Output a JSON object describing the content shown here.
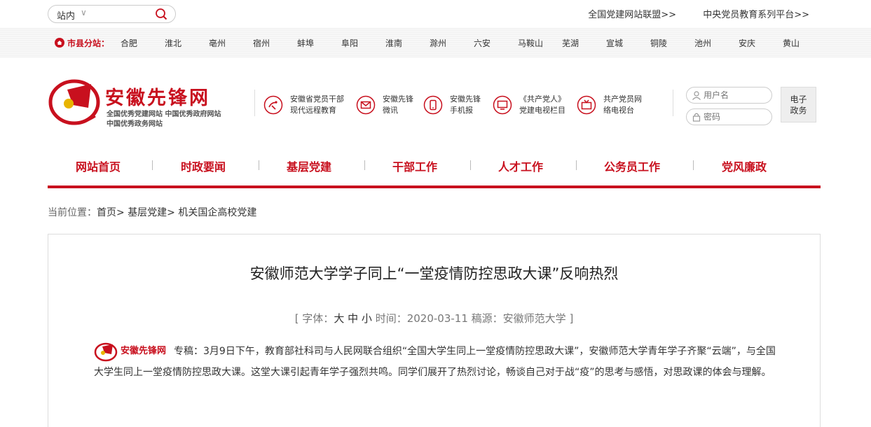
{
  "search": {
    "scope": "站内",
    "placeholder": ""
  },
  "toplinks": [
    "全国党建网站联盟>>",
    "中央党员教育系列平台>>"
  ],
  "citybar": {
    "label": "市县分站：",
    "cities": [
      "合肥",
      "淮北",
      "亳州",
      "宿州",
      "蚌埠",
      "阜阳",
      "淮南",
      "滁州",
      "六安",
      "马鞍山",
      "芜湖",
      "宣城",
      "铜陵",
      "池州",
      "安庆",
      "黄山"
    ]
  },
  "logo": {
    "title": "安徽先锋网",
    "sub1": "全国优秀党建网站   中国优秀政府网站",
    "sub2": "中国优秀政务网站",
    "url": "www.ahxf.gov.cn"
  },
  "services": [
    {
      "line1": "安徽省党员干部",
      "line2": "现代远程教育",
      "icon": "satellite-icon"
    },
    {
      "line1": "安徽先锋",
      "line2": "微讯",
      "icon": "mail-icon"
    },
    {
      "line1": "安徽先锋",
      "line2": "手机报",
      "icon": "phone-icon"
    },
    {
      "line1": "《共产党人》",
      "line2": "党建电视栏目",
      "icon": "tv-icon"
    },
    {
      "line1": "共产党员网",
      "line2": "络电视台",
      "icon": "tv-network-icon"
    }
  ],
  "login": {
    "username_placeholder": "用户名",
    "password_placeholder": "密码"
  },
  "egov": {
    "line1": "电子",
    "line2": "政务"
  },
  "nav": [
    "网站首页",
    "时政要闻",
    "基层党建",
    "干部工作",
    "人才工作",
    "公务员工作",
    "党风廉政"
  ],
  "crumb": {
    "prefix": "当前位置：",
    "items": [
      "首页>",
      "基层党建>",
      "机关国企高校党建"
    ]
  },
  "article": {
    "title": "安徽师范大学学子同上“一堂疫情防控思政大课”反响热烈",
    "meta_open": "[ 字体：",
    "font_sizes": [
      "大",
      "中",
      "小"
    ],
    "meta_time": "时间：2020-03-11",
    "meta_source": "稿源：安徽师范大学 ]",
    "inline_logo": "安徽先锋网",
    "body": "专稿：3月9日下午，教育部社科司与人民网联合组织“全国大学生同上一堂疫情防控思政大课”，安徽师范大学青年学子齐聚“云端”，与全国大学生同上一堂疫情防控思政大课。这堂大课引起青年学子强烈共鸣。同学们展开了热烈讨论，畅谈自己对于战“疫”的思考与感悟，对思政课的体会与理解。"
  },
  "colors": {
    "brand_red": "#c8101e"
  }
}
